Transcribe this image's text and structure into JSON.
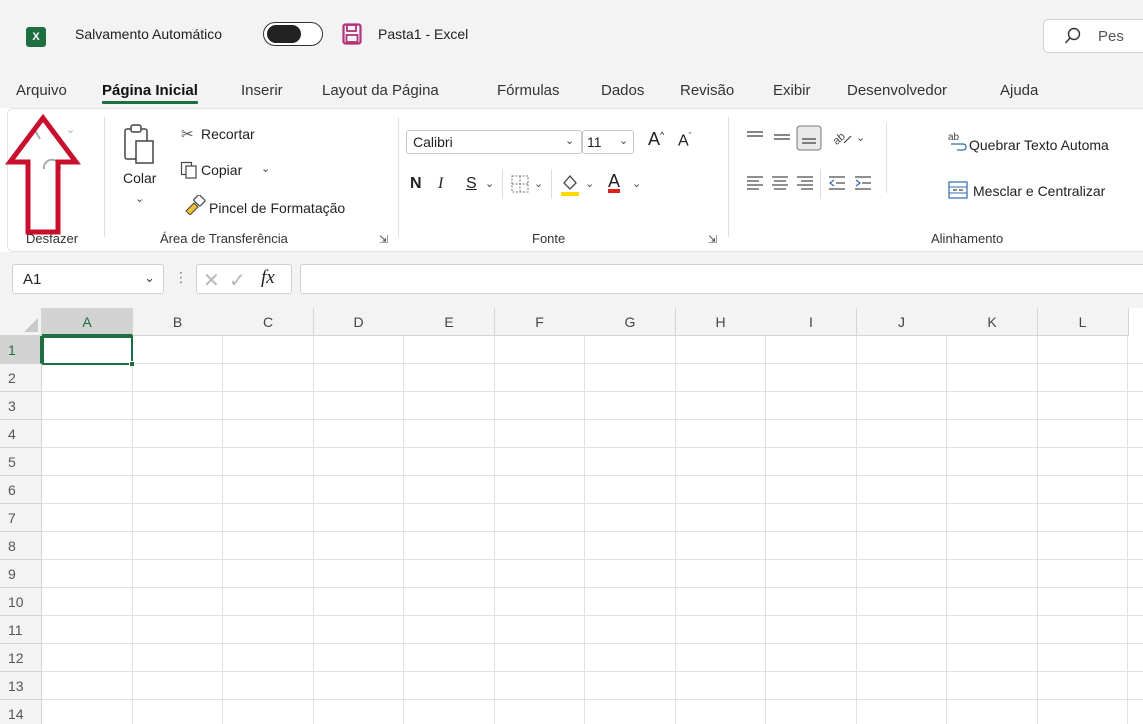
{
  "titlebar": {
    "app_icon_letter": "X",
    "autosave_label": "Salvamento Automático",
    "autosave_state": "off",
    "document_title": "Pasta1 - Excel",
    "search_placeholder": "Pes"
  },
  "menu": {
    "tabs": [
      {
        "label": "Arquivo",
        "active": false
      },
      {
        "label": "Página Inicial",
        "active": true
      },
      {
        "label": "Inserir",
        "active": false
      },
      {
        "label": "Layout da Página",
        "active": false
      },
      {
        "label": "Fórmulas",
        "active": false
      },
      {
        "label": "Dados",
        "active": false
      },
      {
        "label": "Revisão",
        "active": false
      },
      {
        "label": "Exibir",
        "active": false
      },
      {
        "label": "Desenvolvedor",
        "active": false
      },
      {
        "label": "Ajuda",
        "active": false
      }
    ]
  },
  "ribbon": {
    "undo_group_label": "Desfazer",
    "clipboard": {
      "paste_label": "Colar",
      "cut_label": "Recortar",
      "copy_label": "Copiar",
      "format_painter_label": "Pincel de Formatação",
      "group_label": "Área de Transferência"
    },
    "font": {
      "font_name": "Calibri",
      "font_size": "11",
      "bold_label": "N",
      "italic_label": "I",
      "underline_label": "S",
      "font_color_label": "A",
      "grow_label": "A",
      "shrink_label": "A",
      "group_label": "Fonte"
    },
    "alignment": {
      "wrap_text_label": "Quebrar Texto Automa",
      "merge_center_label": "Mesclar e Centralizar",
      "group_label": "Alinhamento"
    }
  },
  "formula_bar": {
    "name_box_value": "A1",
    "fx_label": "fx",
    "formula_value": ""
  },
  "sheet": {
    "columns": [
      "A",
      "B",
      "C",
      "D",
      "E",
      "F",
      "G",
      "H",
      "I",
      "J",
      "K",
      "L"
    ],
    "rows": [
      "1",
      "2",
      "3",
      "4",
      "5",
      "6",
      "7",
      "8",
      "9",
      "10",
      "11",
      "12",
      "13",
      "14"
    ],
    "active_cell": "A1"
  },
  "colors": {
    "accent": "#1d6f42",
    "annotation_arrow": "#c8102e",
    "highlight_fill": "#ffd800",
    "font_color_bar": "#e0201d"
  }
}
